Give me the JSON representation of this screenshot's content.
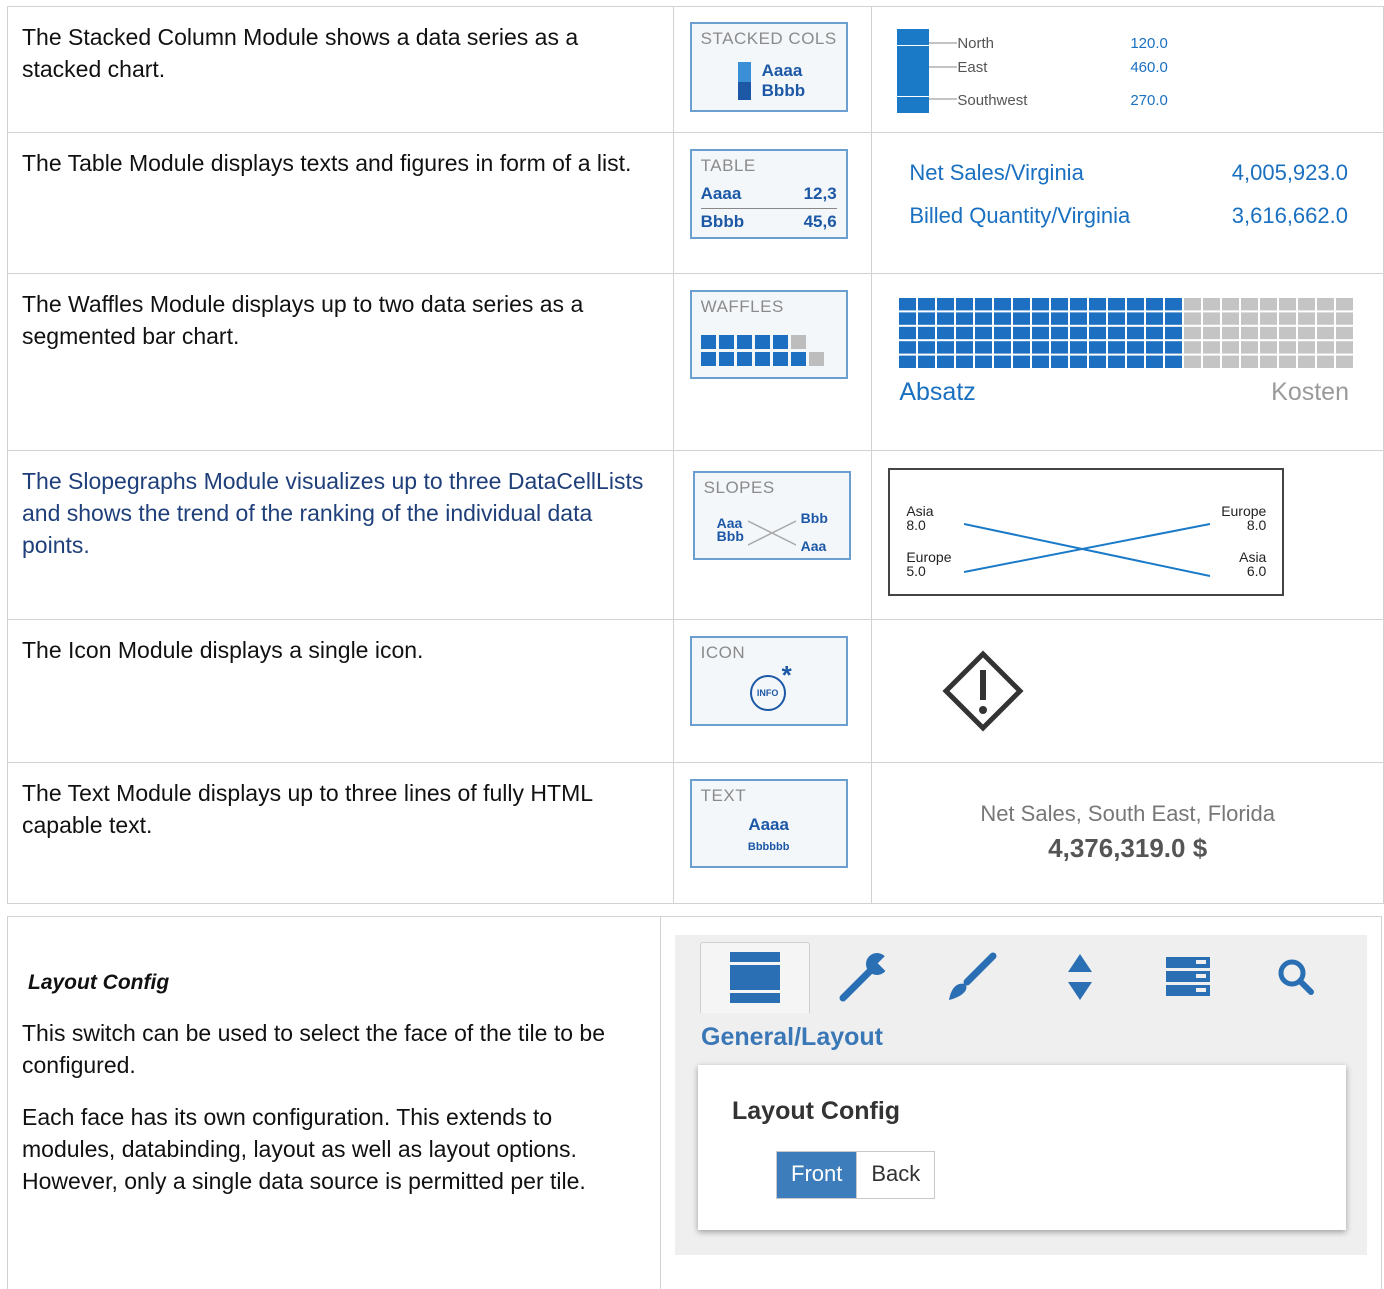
{
  "rows": [
    {
      "desc": "The Stacked Column Module shows a data series as a stacked chart.",
      "mini_label": "STACKED COLS",
      "mini_a": "Aaaa",
      "mini_b": "Bbbb",
      "preview": {
        "items": [
          {
            "label": "North",
            "value": "120.0"
          },
          {
            "label": "East",
            "value": "460.0"
          },
          {
            "label": "Southwest",
            "value": "270.0"
          }
        ]
      }
    },
    {
      "desc": "The Table Module displays texts and figures in form of a list.",
      "mini_label": "TABLE",
      "mini_a": "Aaaa",
      "mini_a_val": "12,3",
      "mini_b": "Bbbb",
      "mini_b_val": "45,6",
      "preview": {
        "rows": [
          {
            "label": "Net Sales/Virginia",
            "value": "4,005,923.0"
          },
          {
            "label": "Billed Quantity/Virginia",
            "value": "3,616,662.0"
          }
        ]
      }
    },
    {
      "desc": "The Waffles Module displays up to two data series as a segmented bar chart.",
      "mini_label": "WAFFLES",
      "preview": {
        "left_label": "Absatz",
        "right_label": "Kosten",
        "share_blue": 0.62
      }
    },
    {
      "desc": "The Slopegraphs Module visualizes up to three DataCellLists and shows the trend of the ranking of the individual data points.",
      "mini_label": "SLOPES",
      "mini_a": "Aaa",
      "mini_b": "Bbb",
      "mini_ra": "Bbb",
      "mini_rb": "Aaa",
      "preview": {
        "left": [
          {
            "label": "Asia",
            "value": "8.0"
          },
          {
            "label": "Europe",
            "value": "5.0"
          }
        ],
        "right": [
          {
            "label": "Europe",
            "value": "8.0"
          },
          {
            "label": "Asia",
            "value": "6.0"
          }
        ]
      }
    },
    {
      "desc": "The Icon Module displays a single icon.",
      "mini_label": "ICON",
      "mini_icon": "INFO",
      "preview": {
        "icon": "warning-diamond-icon"
      }
    },
    {
      "desc": "The Text Module displays up to three lines of fully HTML capable text.",
      "mini_label": "TEXT",
      "mini_a": "Aaaa",
      "mini_b": "Bbbbbb",
      "preview": {
        "line1": "Net Sales, South East, Florida",
        "line2": "4,376,319.0 $"
      }
    }
  ],
  "lower": {
    "heading": "Layout Config",
    "para1": "This switch can be used to select the face of the tile to be configured.",
    "para2": "Each face has its own configuration. This extends to modules, databinding, layout as well as layout options. However, only a single data source is permitted per tile."
  },
  "panel": {
    "section": "General/Layout",
    "card_title": "Layout Config",
    "front": "Front",
    "back": "Back",
    "accent": "#3e7dbb"
  }
}
